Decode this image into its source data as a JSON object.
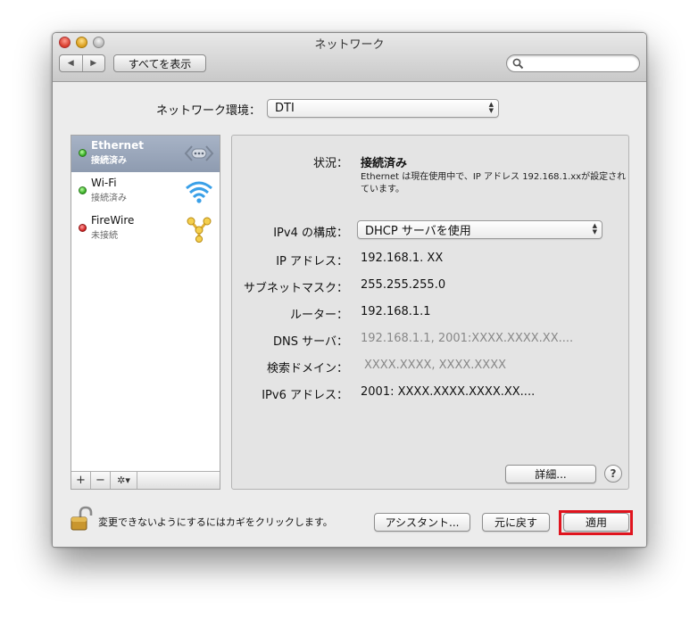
{
  "window": {
    "title": "ネットワーク",
    "toolbar": {
      "back_icon": "◀",
      "forward_icon": "▶",
      "show_all_label": "すべてを表示",
      "search_placeholder": ""
    }
  },
  "location": {
    "label": "ネットワーク環境：",
    "value": "DTI"
  },
  "services": [
    {
      "name": "Ethernet",
      "status": "接続済み",
      "indicator": "green",
      "icon": "ethernet-arrows-icon",
      "selected": true
    },
    {
      "name": "Wi-Fi",
      "status": "接続済み",
      "indicator": "green",
      "icon": "wifi-icon",
      "selected": false
    },
    {
      "name": "FireWire",
      "status": "未接続",
      "indicator": "red",
      "icon": "firewire-icon",
      "selected": false
    }
  ],
  "sidebar_toolbar": {
    "add": "+",
    "remove": "−",
    "action": "✲▾"
  },
  "details": {
    "status_label": "状況：",
    "status_value": "接続済み",
    "status_description": "Ethernet は現在使用中で、IP アドレス 192.168.1.xxが設定されています。",
    "ipv4_label": "IPv4 の構成：",
    "ipv4_value": "DHCP サーバを使用",
    "ip_label": "IP アドレス：",
    "ip_value": "192.168.1. XX",
    "subnet_label": "サブネットマスク：",
    "subnet_value": "255.255.255.0",
    "router_label": "ルーター：",
    "router_value": "192.168.1.1",
    "dns_label": "DNS サーバ：",
    "dns_value": "192.168.1.1, 2001:XXXX.XXXX.XX....",
    "search_domain_label": "検索ドメイン：",
    "search_domain_value": "XXXX.XXXX, XXXX.XXXX",
    "ipv6_label": "IPv6 アドレス：",
    "ipv6_value": "2001: XXXX.XXXX.XXXX.XX....",
    "advanced_label": "詳細...",
    "help_label": "?"
  },
  "footer": {
    "lock_text": "変更できないようにするにはカギをクリックします。",
    "assistant_label": "アシスタント...",
    "revert_label": "元に戻す",
    "apply_label": "適用"
  },
  "colors": {
    "highlight": "#e0141e",
    "selected_row": "#9aa6ba",
    "connected": "#2fa81e",
    "disconnected": "#cf1d1d"
  }
}
